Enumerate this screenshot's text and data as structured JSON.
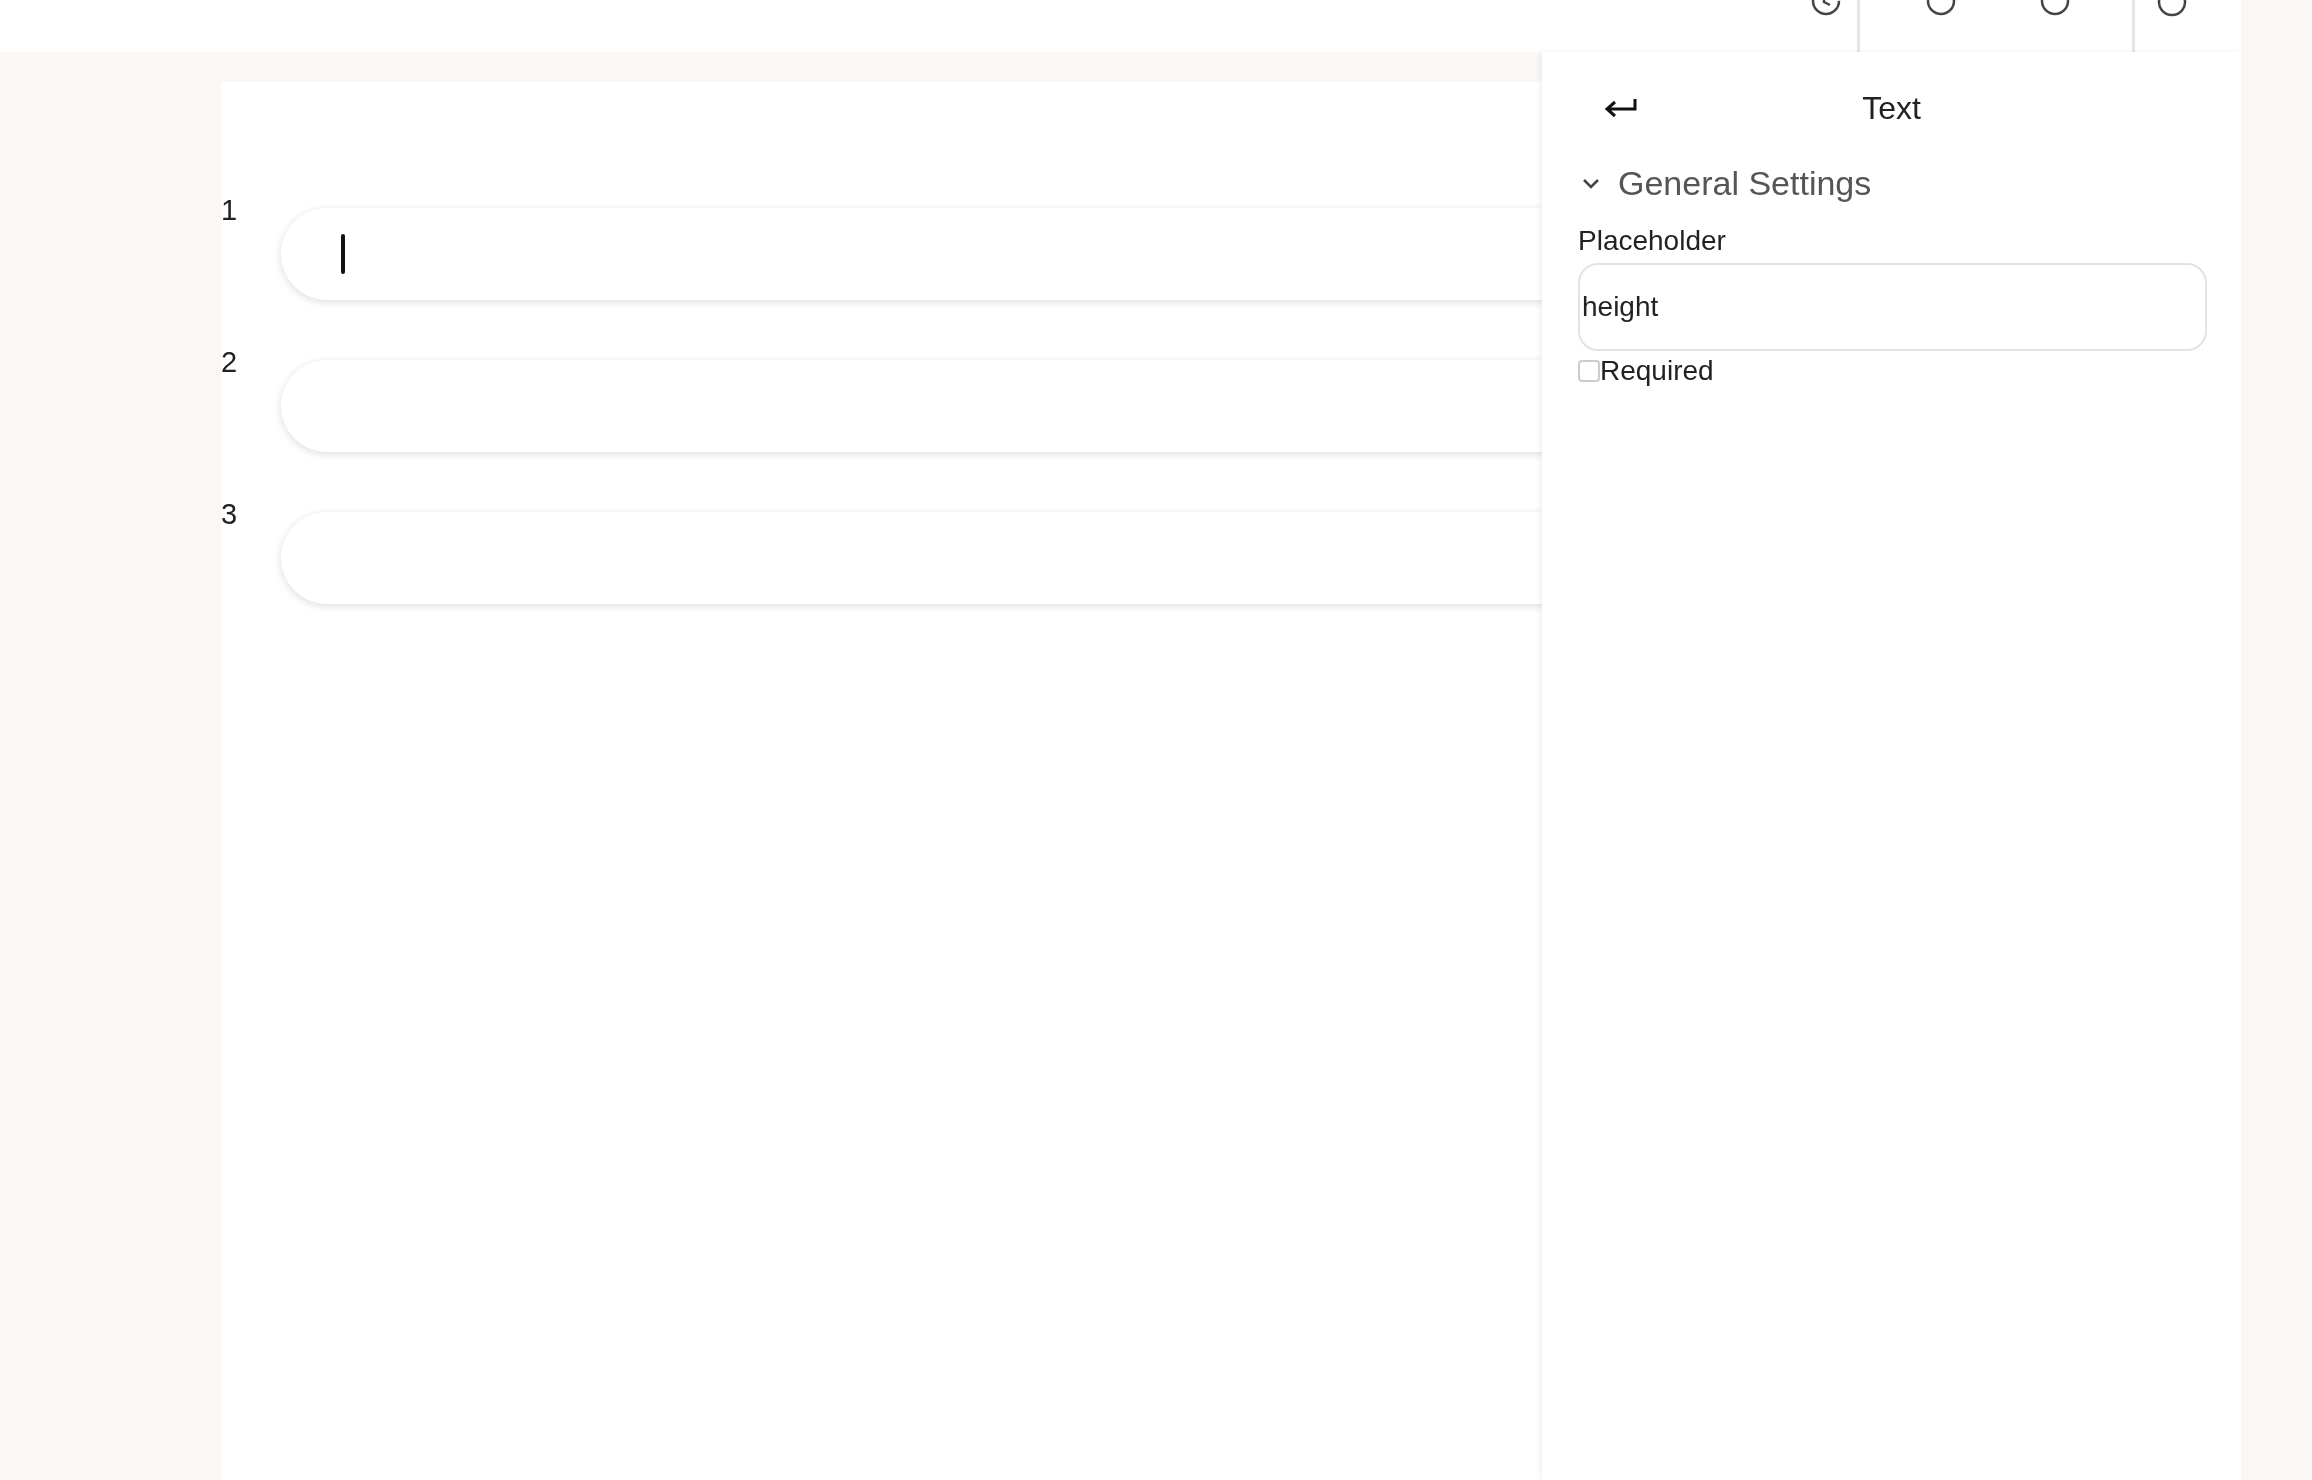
{
  "canvas": {
    "fields": [
      {
        "number": "1",
        "focused": true
      },
      {
        "number": "2",
        "focused": false
      },
      {
        "number": "3",
        "focused": false
      }
    ]
  },
  "panel": {
    "title": "Text",
    "section": {
      "title": "General Settings",
      "expanded": true
    },
    "placeholder_setting": {
      "label": "Placeholder",
      "value": "height"
    },
    "required": {
      "label": "Required",
      "checked": false
    }
  }
}
